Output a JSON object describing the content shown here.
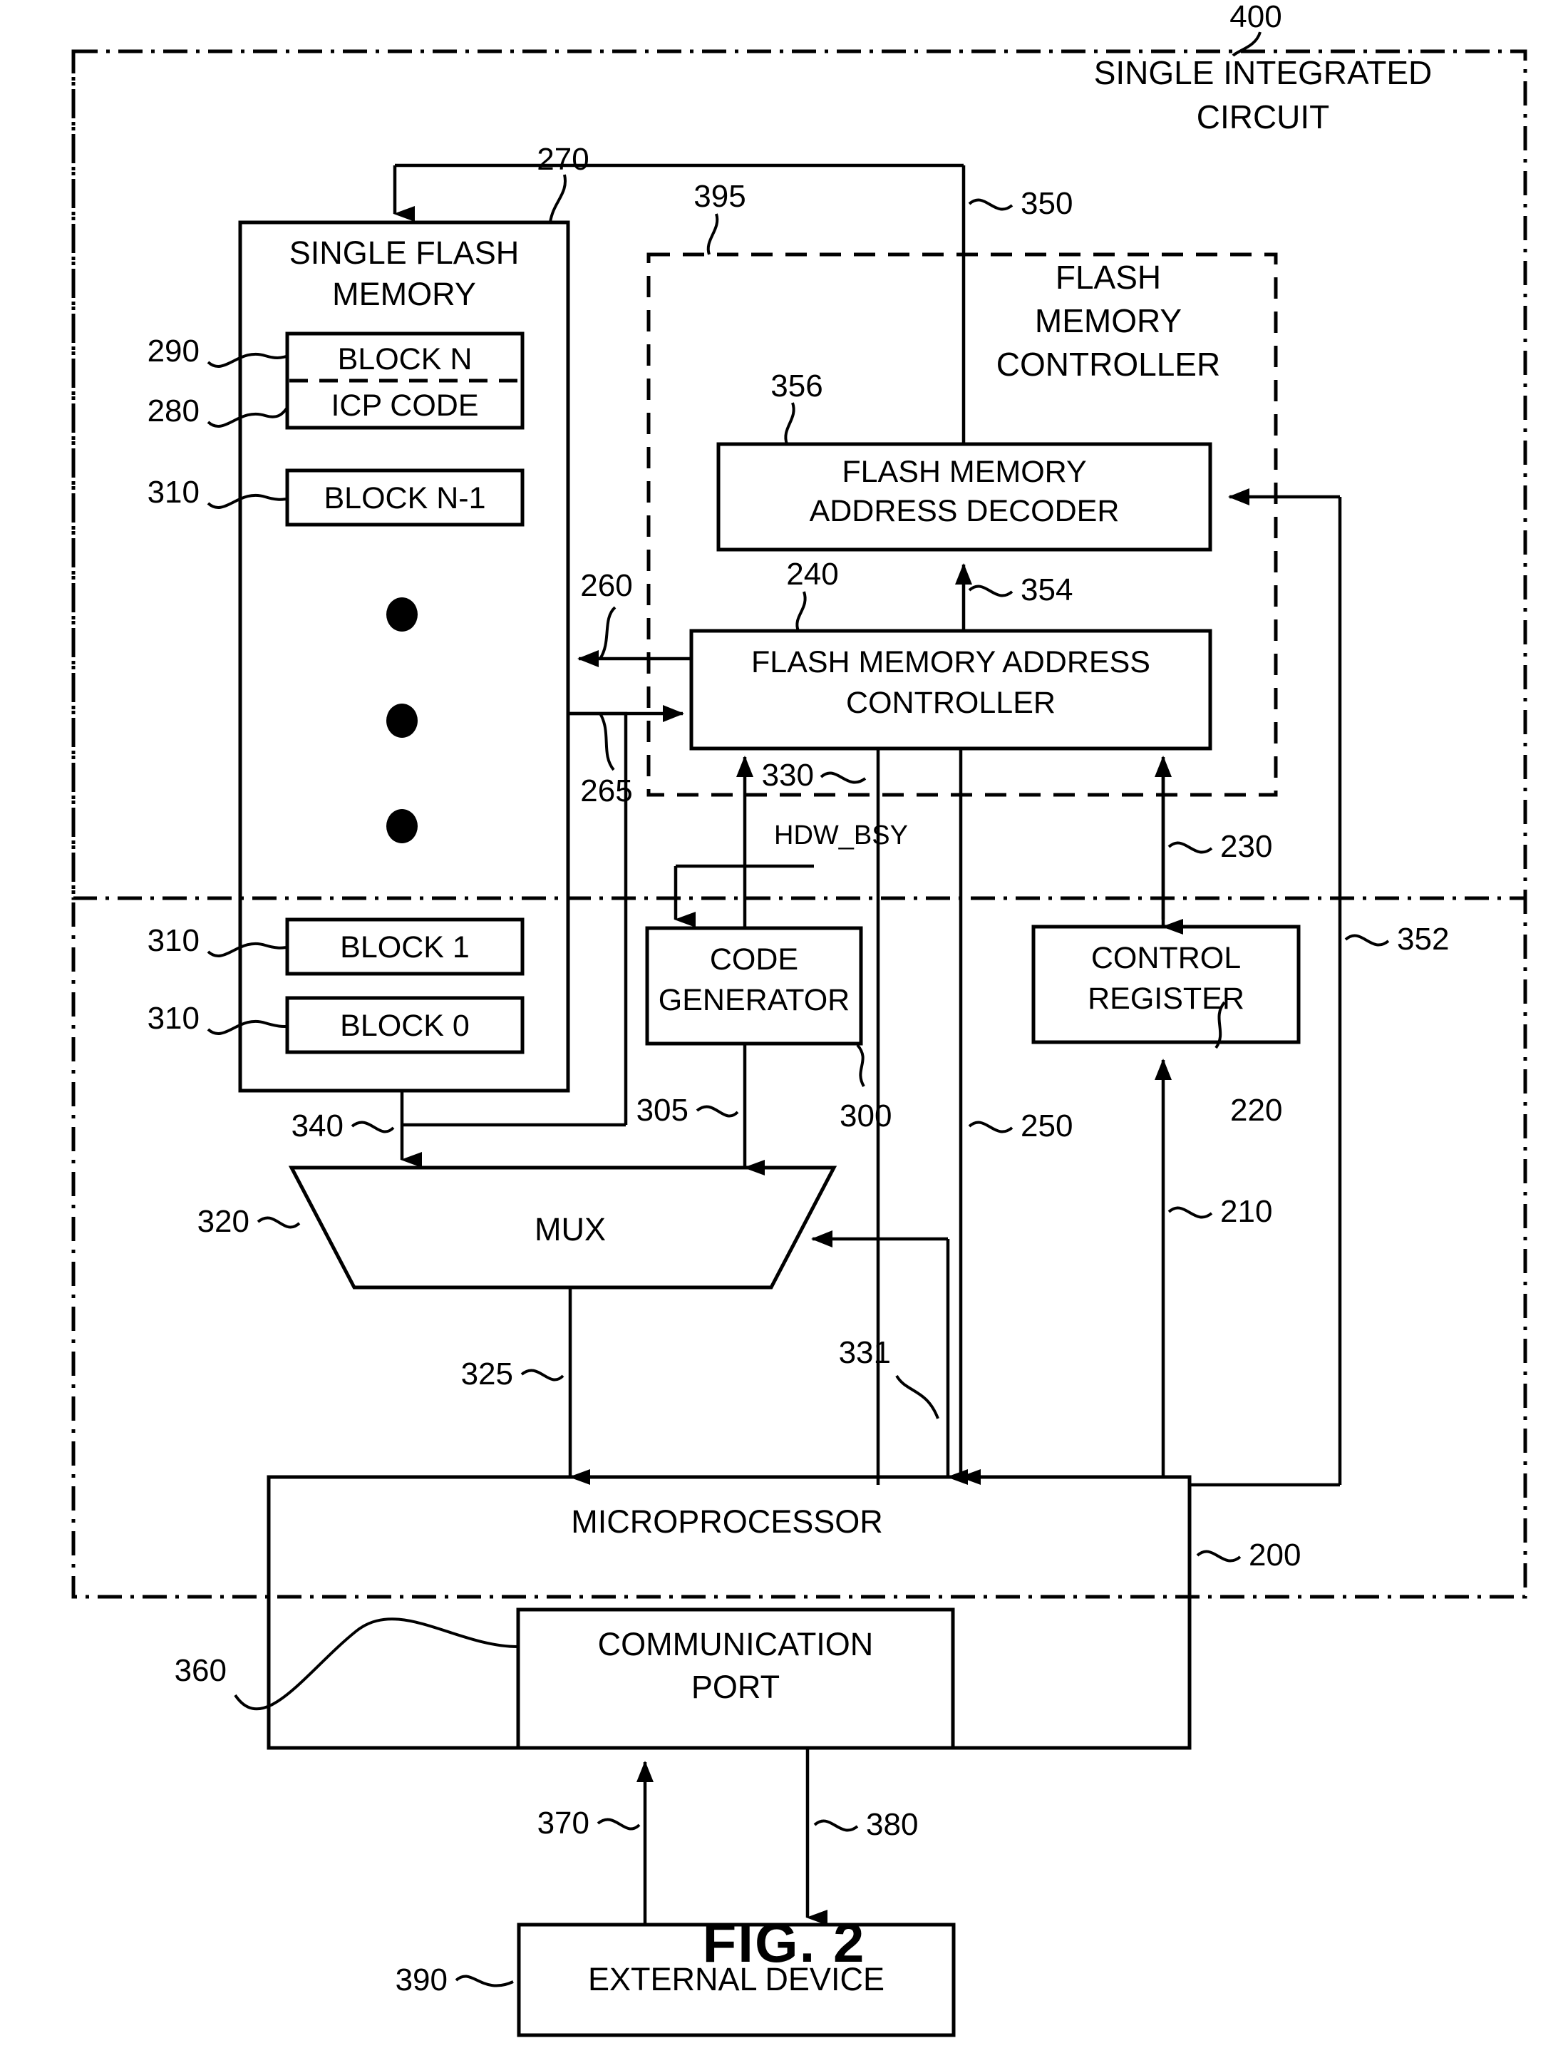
{
  "figure": {
    "caption": "FIG. 2",
    "chip_label_line1": "SINGLE INTEGRATED",
    "chip_label_line2": "CIRCUIT",
    "chip_ref": "400"
  },
  "blocks": {
    "flash_memory": {
      "label_line1": "SINGLE FLASH",
      "label_line2": "MEMORY",
      "ref": "270",
      "items": [
        {
          "label": "BLOCK N",
          "ref": "290"
        },
        {
          "label": "ICP CODE",
          "ref": "280"
        },
        {
          "label": "BLOCK N-1",
          "ref": "310"
        },
        {
          "label": "BLOCK 1",
          "ref": "310"
        },
        {
          "label": "BLOCK 0",
          "ref": "310"
        }
      ]
    },
    "flash_controller": {
      "label_line1": "FLASH",
      "label_line2": "MEMORY",
      "label_line3": "CONTROLLER",
      "ref": "395"
    },
    "address_decoder": {
      "label_line1": "FLASH MEMORY",
      "label_line2": "ADDRESS DECODER",
      "ref": "356"
    },
    "address_controller": {
      "label_line1": "FLASH MEMORY ADDRESS",
      "label_line2": "CONTROLLER",
      "ref": "240"
    },
    "code_generator": {
      "label_line1": "CODE",
      "label_line2": "GENERATOR",
      "ref": "300"
    },
    "control_register": {
      "label_line1": "CONTROL",
      "label_line2": "REGISTER",
      "ref": "230"
    },
    "mux": {
      "label": "MUX",
      "ref": "320"
    },
    "microprocessor": {
      "label": "MICROPROCESSOR",
      "ref": "200"
    },
    "communication_port": {
      "label_line1": "COMMUNICATION",
      "label_line2": "PORT",
      "ref": "360"
    },
    "external_device": {
      "label": "EXTERNAL DEVICE",
      "ref": "390"
    }
  },
  "signals": {
    "hdw_bsy": "HDW_BSY"
  },
  "refs": {
    "r200": "200",
    "r210": "210",
    "r220": "220",
    "r230": "230",
    "r240": "240",
    "r250": "250",
    "r260": "260",
    "r265": "265",
    "r270": "270",
    "r280": "280",
    "r290": "290",
    "r300": "300",
    "r305": "305",
    "r310_a": "310",
    "r310_b": "310",
    "r310_c": "310",
    "r320": "320",
    "r325": "325",
    "r330": "330",
    "r331": "331",
    "r340": "340",
    "r350": "350",
    "r352": "352",
    "r354": "354",
    "r356": "356",
    "r360": "360",
    "r370": "370",
    "r380": "380",
    "r390": "390",
    "r395": "395",
    "r400": "400"
  },
  "colors": {
    "ink": "#000000",
    "paper": "#ffffff"
  }
}
